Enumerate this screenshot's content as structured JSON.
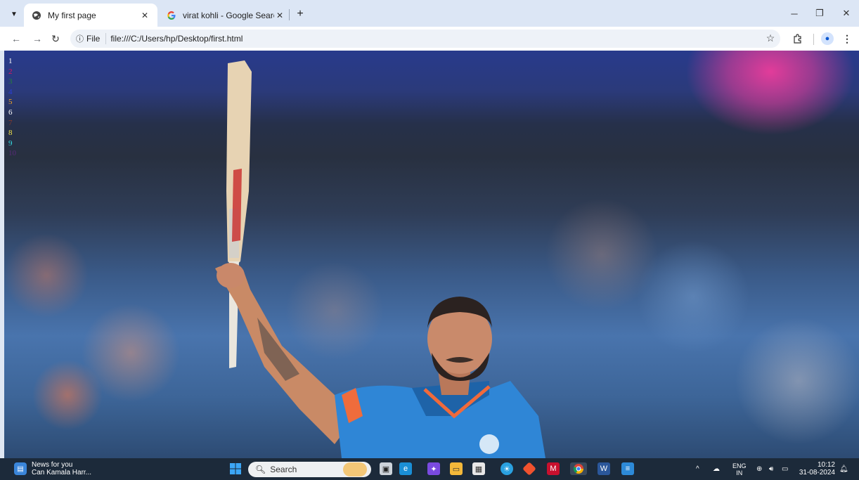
{
  "browser": {
    "tabs": [
      {
        "label": "My first page",
        "icon": "globe-icon",
        "active": true
      },
      {
        "label": "virat kohli - Google Search",
        "icon": "google-icon",
        "active": false
      }
    ],
    "new_tab_label": "+",
    "address_chip": "File",
    "url": "file:///C:/Users/hp/Desktop/first.html"
  },
  "page": {
    "list_items": [
      {
        "text": "1",
        "color": "#ffffff"
      },
      {
        "text": "2",
        "color": "#e0155f"
      },
      {
        "text": "3",
        "color": "#27823b"
      },
      {
        "text": "4",
        "color": "#2a3fd6"
      },
      {
        "text": "5",
        "color": "#f5a623"
      },
      {
        "text": "6",
        "color": "#ffffff"
      },
      {
        "text": "7",
        "color": "#8b3a2a"
      },
      {
        "text": "8",
        "color": "#f2e34a"
      },
      {
        "text": "9",
        "color": "#35e0e6"
      },
      {
        "text": "10",
        "color": "#5a2a7a"
      }
    ]
  },
  "taskbar": {
    "news_title": "News for you",
    "news_subtitle": "Can Kamala Harr...",
    "search_placeholder": "Search",
    "lang_top": "ENG",
    "lang_bottom": "IN",
    "time": "10:12",
    "date": "31-08-2024"
  },
  "colors": {
    "tabstrip": "#dce6f5",
    "taskbar": "#1c2a3a",
    "accent": "#0b57d0"
  }
}
